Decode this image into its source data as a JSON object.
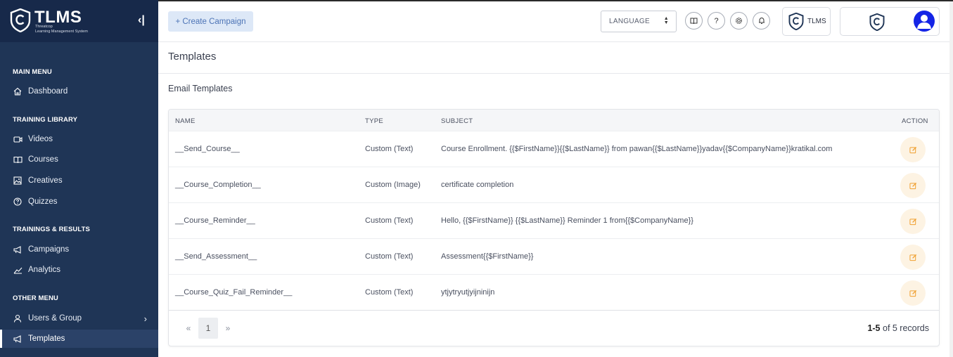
{
  "sidebar": {
    "brand": "TLMS",
    "brand_sub1": "Threatcop",
    "brand_sub2": "Learning Management System",
    "collapse_icon": "‹|",
    "sections": {
      "main": "MAIN MENU",
      "library": "TRAINING LIBRARY",
      "results": "TRAININGS & RESULTS",
      "other": "OTHER MENU"
    },
    "items": {
      "dashboard": "Dashboard",
      "videos": "Videos",
      "courses": "Courses",
      "creatives": "Creatives",
      "quizzes": "Quizzes",
      "campaigns": "Campaigns",
      "analytics": "Analytics",
      "users_group": "Users & Group",
      "templates": "Templates"
    }
  },
  "header": {
    "create_campaign": "+ Create Campaign",
    "language_label": "LANGUAGE",
    "org_name": "TLMS",
    "icons": [
      "book-icon",
      "help-icon",
      "settings-icon",
      "bell-icon"
    ]
  },
  "main": {
    "title": "Templates",
    "subtitle": "Email Templates",
    "table": {
      "headers": {
        "name": "NAME",
        "type": "TYPE",
        "subject": "SUBJECT",
        "action": "ACTION"
      },
      "rows": [
        {
          "name": "__Send_Course__",
          "type": "Custom (Text)",
          "subject": "Course Enrollment. {{$FirstName}}{{$LastName}} from pawan{{$LastName}}yadav{{$CompanyName}}kratikal.com"
        },
        {
          "name": "__Course_Completion__",
          "type": "Custom (Image)",
          "subject": "certificate completion"
        },
        {
          "name": "__Course_Reminder__",
          "type": "Custom (Text)",
          "subject": "Hello, {{$FirstName}} {{$LastName}} Reminder 1 from{{$CompanyName}}"
        },
        {
          "name": "__Send_Assessment__",
          "type": "Custom (Text)",
          "subject": "Assessment{{$FirstName}}"
        },
        {
          "name": "__Course_Quiz_Fail_Reminder__",
          "type": "Custom (Text)",
          "subject": "ytjytryutjyijninijn"
        }
      ]
    },
    "pagination": {
      "prev": "«",
      "current": "1",
      "next": "»",
      "range": "1-5",
      "of_text": " of 5 records"
    }
  },
  "colors": {
    "sidebar_bg": "#1f3556",
    "sidebar_logo_bg": "#17294a",
    "accent_blue": "#4d74b6",
    "edit_bg": "#fdf3e3",
    "edit_icon": "#f0a030",
    "avatar": "#1424e6"
  }
}
